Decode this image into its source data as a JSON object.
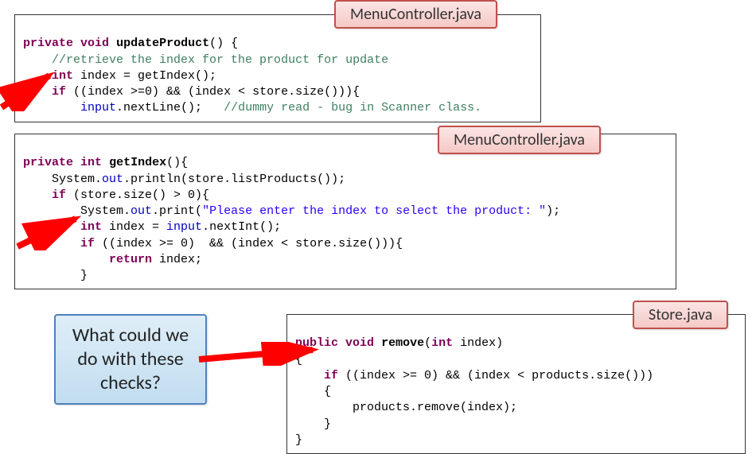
{
  "labels": {
    "box1": "MenuController.java",
    "box2": "MenuController.java",
    "box3": "Store.java"
  },
  "callout": "What could we do with these checks?",
  "code1": {
    "line1_a": "private",
    "line1_b": "void",
    "line1_c": "updateProduct",
    "line1_d": "() {",
    "line2": "//retrieve the index for the product for update",
    "line3_a": "int",
    "line3_b": " index = getIndex();",
    "line4_a": "if",
    "line4_b": " ((index >=0) && (index < store.size())){",
    "line5_a": "input",
    "line5_b": ".nextLine();   ",
    "line5_c": "//dummy read - bug in Scanner class."
  },
  "code2": {
    "line1_a": "private",
    "line1_b": "int",
    "line1_c": "getIndex",
    "line1_d": "(){",
    "line2_a": "System.",
    "line2_b": "out",
    "line2_c": ".println(store.listProducts());",
    "line3_a": "if",
    "line3_b": " (store.size() > 0){",
    "line4_a": "System.",
    "line4_b": "out",
    "line4_c": ".print(",
    "line4_d": "\"Please enter the index to select the product: \"",
    "line4_e": ");",
    "line5_a": "int",
    "line5_b": " index = ",
    "line5_c": "input",
    "line5_d": ".nextInt();",
    "line6_a": "if",
    "line6_b": " ((index >= 0)  && (index < store.size())){",
    "line7_a": "return",
    "line7_b": " index;",
    "line8": "}"
  },
  "code3": {
    "line1_a": "public",
    "line1_b": "void",
    "line1_c": "remove",
    "line1_d": "(",
    "line1_e": "int",
    "line1_f": " index)",
    "line2": "{",
    "line3_a": "if",
    "line3_b": " ((index >= 0) && (index < products.size()))",
    "line4": "{",
    "line5": "products.remove(index);",
    "line6": "}",
    "line7": "}"
  },
  "colors": {
    "arrow": "#ff0000",
    "labelBorder": "#c0504d",
    "calloutBorder": "#4f81bd"
  }
}
